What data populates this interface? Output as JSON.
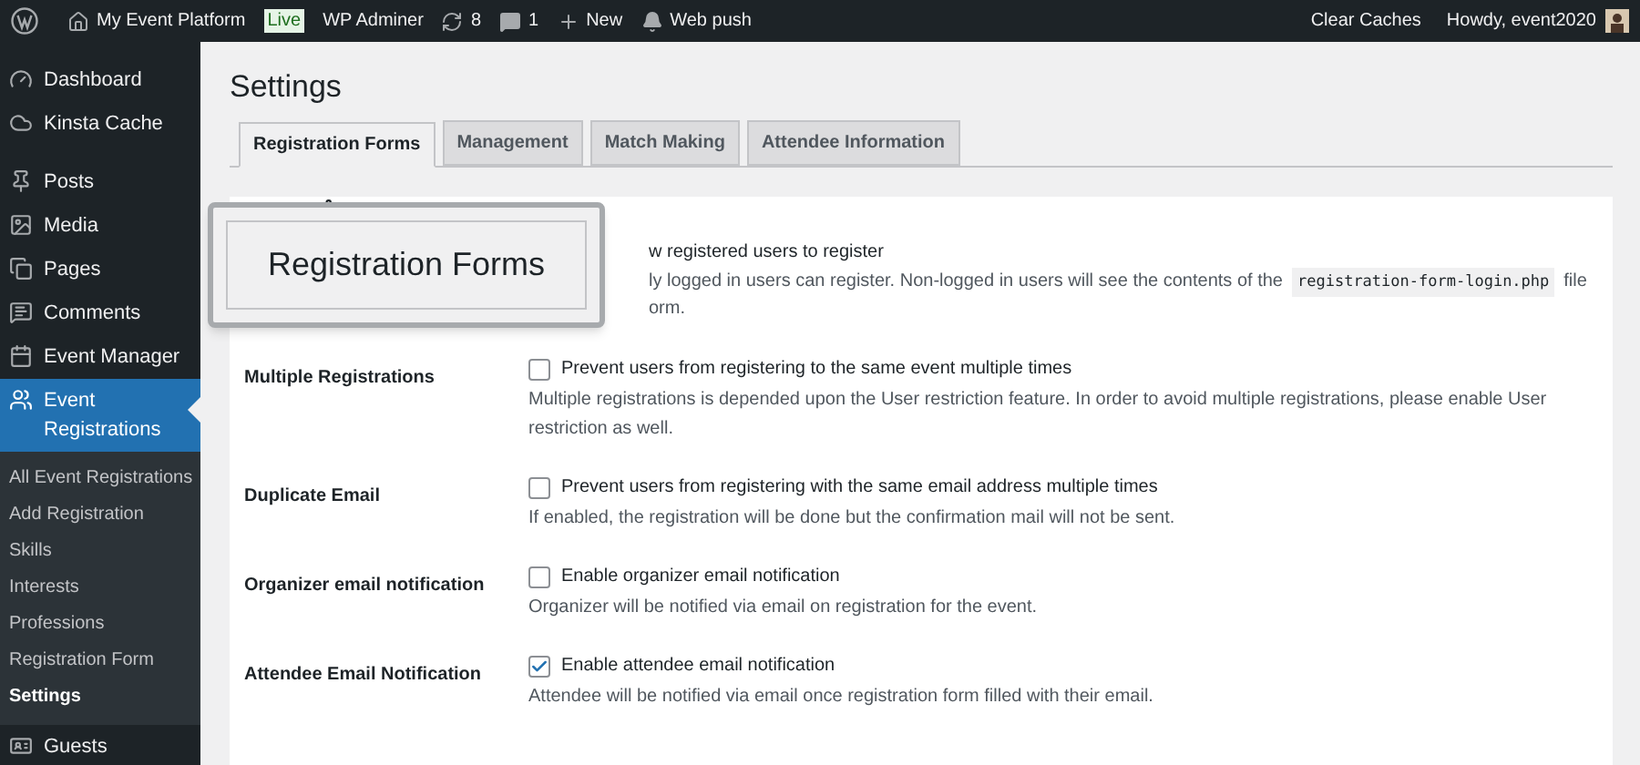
{
  "admin_bar": {
    "site_name": "My Event Platform",
    "live_badge": "Live",
    "adminer": "WP Adminer",
    "updates": "8",
    "comments": "1",
    "new": "New",
    "web_push": "Web push",
    "clear_caches": "Clear Caches",
    "howdy": "Howdy, event2020"
  },
  "sidebar": {
    "items": [
      {
        "label": "Dashboard",
        "selected": false
      },
      {
        "label": "Kinsta Cache",
        "selected": false
      },
      {
        "label": "Posts",
        "selected": false
      },
      {
        "label": "Media",
        "selected": false
      },
      {
        "label": "Pages",
        "selected": false
      },
      {
        "label": "Comments",
        "selected": false
      },
      {
        "label": "Event Manager",
        "selected": false
      },
      {
        "label": "Event Registrations",
        "selected": true,
        "children": [
          {
            "label": "All Event Registrations",
            "selected": false
          },
          {
            "label": "Add Registration",
            "selected": false
          },
          {
            "label": "Skills",
            "selected": false
          },
          {
            "label": "Interests",
            "selected": false
          },
          {
            "label": "Professions",
            "selected": false
          },
          {
            "label": "Registration Form",
            "selected": false
          },
          {
            "label": "Settings",
            "selected": true
          }
        ]
      },
      {
        "label": "Guests",
        "selected": false
      }
    ]
  },
  "page_title": "Settings",
  "tabs": [
    {
      "label": "Registration Forms",
      "selected": true
    },
    {
      "label": "Management",
      "selected": false
    },
    {
      "label": "Match Making",
      "selected": false
    },
    {
      "label": "Attendee Information",
      "selected": false
    }
  ],
  "zoom_callout": {
    "label": "Registration Forms"
  },
  "first_row": {
    "option": "w registered users to register",
    "description_start": "ly logged in users can register. Non-logged in users will see the contents of the",
    "code": "registration-form-login.php",
    "description_end": "file",
    "description_line2": "orm."
  },
  "rows": [
    {
      "label": "Multiple Registrations",
      "option": "Prevent users from registering to the same event multiple times",
      "checked": false,
      "description": "Multiple registrations is depended upon the User restriction feature. In order to avoid multiple registrations, please enable User restriction as well."
    },
    {
      "label": "Duplicate Email",
      "option": "Prevent users from registering with the same email address multiple times",
      "checked": false,
      "description": "If enabled, the registration will be done but the confirmation mail will not be sent."
    },
    {
      "label": "Organizer email notification",
      "option": "Enable organizer email notification",
      "checked": false,
      "description": "Organizer will be notified via email on registration for the event."
    },
    {
      "label": "Attendee Email Notification",
      "option": "Enable attendee email notification",
      "checked": true,
      "description": "Attendee will be notified via email once registration form filled with their email."
    }
  ]
}
